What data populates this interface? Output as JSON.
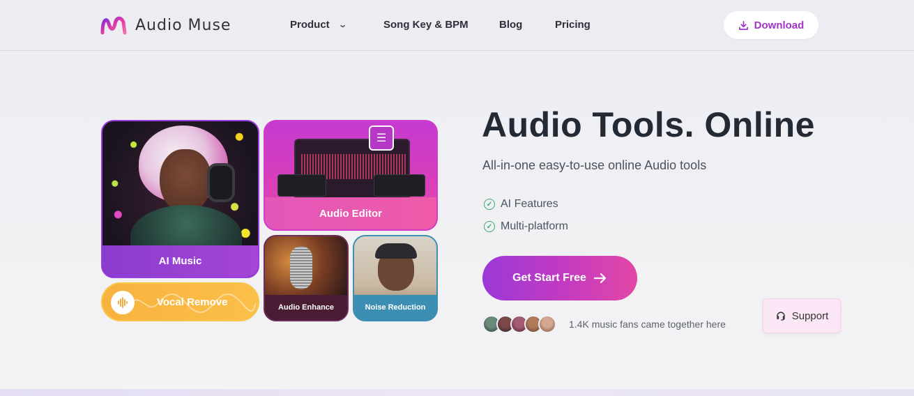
{
  "brand": {
    "name": "Audio Muse",
    "icon": "audio-muse-logo"
  },
  "nav": {
    "items": [
      {
        "label": "Product",
        "has_dropdown": true
      },
      {
        "label": "Song Key & BPM"
      },
      {
        "label": "Blog"
      },
      {
        "label": "Pricing"
      }
    ],
    "download_label": "Download",
    "download_icon": "download-icon"
  },
  "tools": {
    "ai_music": "AI Music",
    "audio_editor": "Audio Editor",
    "audio_enhance": "Audio Enhance",
    "noise_reduction": "Noise Reduction",
    "vocal_remove": "Vocal Remove"
  },
  "hero": {
    "title": "Audio Tools. Online",
    "subtitle": "All-in-one easy-to-use online Audio tools",
    "features": [
      "AI Features",
      "Multi-platform"
    ],
    "cta_label": "Get Start Free",
    "fans_text": "1.4K music fans came together here"
  },
  "support": {
    "label": "Support",
    "icon": "headset-icon"
  },
  "colors": {
    "accent_purple": "#9b38d8",
    "accent_pink": "#e347a6",
    "download_text": "#a233c9",
    "check_green": "#3aa96a",
    "vocal_orange": "#f8b23e",
    "noise_blue": "#3c8fb3"
  }
}
